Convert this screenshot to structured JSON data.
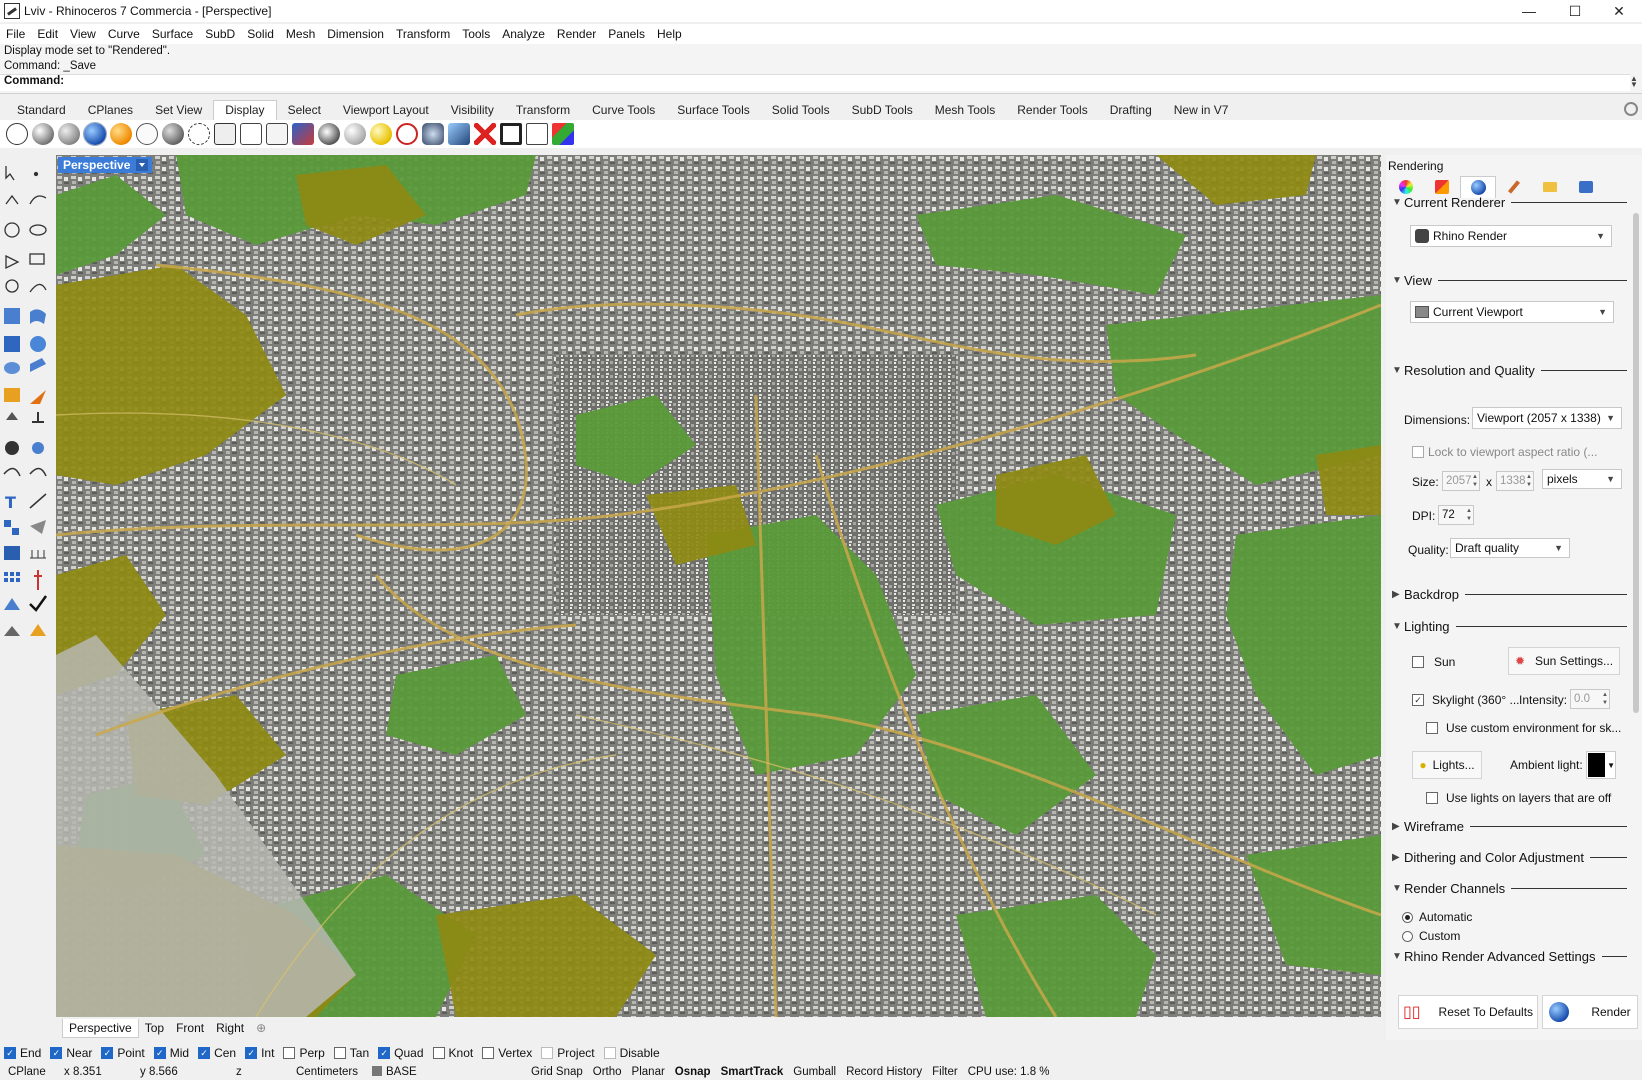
{
  "window": {
    "title": "Lviv - Rhinoceros 7 Commercia - [Perspective]",
    "controls": [
      "—",
      "☐",
      "✕"
    ]
  },
  "menu": [
    "File",
    "Edit",
    "View",
    "Curve",
    "Surface",
    "SubD",
    "Solid",
    "Mesh",
    "Dimension",
    "Transform",
    "Tools",
    "Analyze",
    "Render",
    "Panels",
    "Help"
  ],
  "command": {
    "history": [
      "Display mode set to \"Rendered\".",
      "Command: _Save"
    ],
    "prompt": "Command:"
  },
  "toolbar_tabs": [
    "Standard",
    "CPlanes",
    "Set View",
    "Display",
    "Select",
    "Viewport Layout",
    "Visibility",
    "Transform",
    "Curve Tools",
    "Surface Tools",
    "Solid Tools",
    "SubD Tools",
    "Mesh Tools",
    "Render Tools",
    "Drafting",
    "New in V7"
  ],
  "toolbar_active_tab": "Display",
  "toolbar_icons": [
    "wireframe-sphere-icon",
    "shaded-sphere-icon",
    "rendered-sphere-icon",
    "ghosted-sphere-icon",
    "xray-sphere-icon",
    "technical-sphere-icon",
    "artistic-sphere-icon",
    "pen-sphere-icon",
    "monochrome-icon",
    "lock-view-icon",
    "clipping-icon",
    "capture-icon",
    "display-options-icon",
    "light-sphere-icon",
    "sun-sphere-icon",
    "target-icon",
    "camera-icon",
    "named-view-icon",
    "disable-icon",
    "monitor-icon",
    "boxes-icon",
    "color-boxes-icon"
  ],
  "viewport": {
    "label": "Perspective",
    "tabs": [
      "Perspective",
      "Top",
      "Front",
      "Right"
    ],
    "add_tab": "⊕"
  },
  "osnaps": [
    {
      "label": "End",
      "checked": true
    },
    {
      "label": "Near",
      "checked": true
    },
    {
      "label": "Point",
      "checked": true
    },
    {
      "label": "Mid",
      "checked": true
    },
    {
      "label": "Cen",
      "checked": true
    },
    {
      "label": "Int",
      "checked": true
    },
    {
      "label": "Perp",
      "checked": false
    },
    {
      "label": "Tan",
      "checked": false
    },
    {
      "label": "Quad",
      "checked": true
    },
    {
      "label": "Knot",
      "checked": false
    },
    {
      "label": "Vertex",
      "checked": false
    },
    {
      "label": "Project",
      "checked": false
    },
    {
      "label": "Disable",
      "checked": false
    }
  ],
  "status": {
    "cplane": "CPlane",
    "x": "x 8.351",
    "y": "y 8.566",
    "z": "z",
    "units": "Centimeters",
    "layer": "BASE",
    "toggles": [
      "Grid Snap",
      "Ortho",
      "Planar",
      "Osnap",
      "SmartTrack",
      "Gumball",
      "Record History",
      "Filter"
    ],
    "bold_toggles": [
      "Osnap",
      "SmartTrack"
    ],
    "cpu": "CPU use: 1.8 %"
  },
  "panel": {
    "title": "Rendering",
    "tabs": [
      "color-wheel-icon",
      "material-icon",
      "environment-sphere-icon",
      "texture-brush-icon",
      "folder-icon",
      "render-settings-icon"
    ],
    "current_renderer": {
      "heading": "Current Renderer",
      "value": "Rhino Render"
    },
    "view": {
      "heading": "View",
      "value": "Current Viewport"
    },
    "resolution": {
      "heading": "Resolution and Quality",
      "dimensions_label": "Dimensions:",
      "dimensions_value": "Viewport (2057 x 1338)",
      "lock_label": "Lock to viewport aspect ratio (...",
      "size_label": "Size:",
      "width": "2057",
      "times": "x",
      "height": "1338",
      "unit": "pixels",
      "dpi_label": "DPI:",
      "dpi": "72",
      "quality_label": "Quality:",
      "quality": "Draft quality"
    },
    "backdrop": {
      "heading": "Backdrop"
    },
    "lighting": {
      "heading": "Lighting",
      "sun_label": "Sun",
      "sun_settings": "Sun Settings...",
      "skylight_label": "Skylight (360° ...",
      "intensity_label": "Intensity:",
      "intensity": "0.0",
      "custom_env_label": "Use custom environment for sk...",
      "lights_button": "Lights...",
      "ambient_label": "Ambient light:",
      "layers_off_label": "Use lights on layers that are off"
    },
    "wireframe": {
      "heading": "Wireframe"
    },
    "dithering": {
      "heading": "Dithering and Color Adjustment"
    },
    "channels": {
      "heading": "Render Channels",
      "automatic": "Automatic",
      "custom": "Custom"
    },
    "advanced": {
      "heading": "Rhino Render Advanced Settings"
    },
    "reset_button": "Reset To Defaults",
    "render_button": "Render"
  },
  "colors": {
    "accent": "#3b7cd8",
    "map_green": "#5a9a3a",
    "map_olive": "#8e8a12",
    "map_gray": "#8a8a86",
    "map_road": "#c9a84a"
  }
}
